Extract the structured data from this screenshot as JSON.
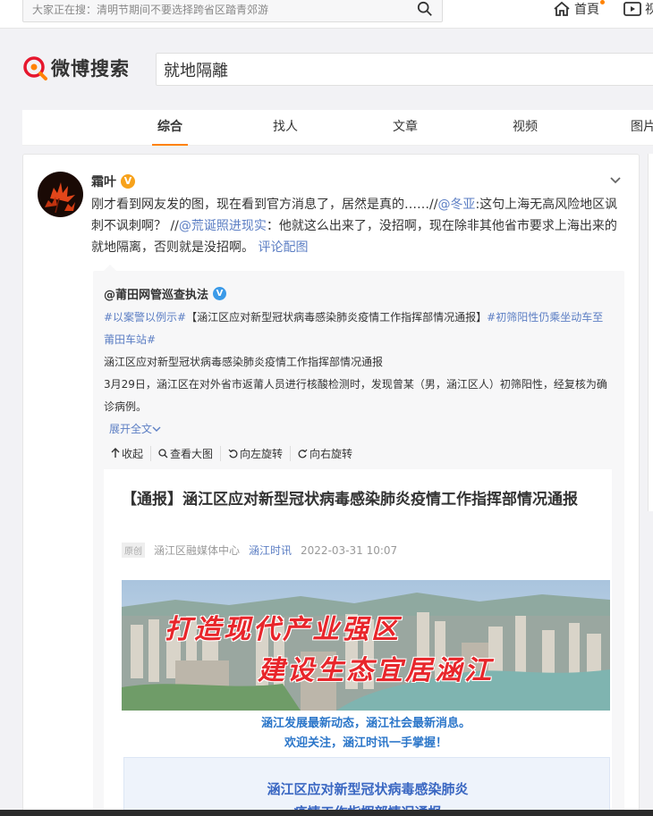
{
  "topbar": {
    "search_placeholder": "大家正在搜：清明节期间不要选择跨省区踏青郊游",
    "home_label": "首頁",
    "video_label": "视"
  },
  "header": {
    "logo_text": "微博搜索",
    "search_value": "就地隔離"
  },
  "tabs": [
    {
      "label": "综合",
      "active": true
    },
    {
      "label": "找人",
      "active": false
    },
    {
      "label": "文章",
      "active": false
    },
    {
      "label": "视频",
      "active": false
    },
    {
      "label": "图片",
      "active": false
    }
  ],
  "post": {
    "username": "霜叶",
    "verified_badge": "V",
    "text_part1": "刚才看到网友发的图，现在看到官方消息了，居然是真的……//",
    "mention1": "@冬亚",
    "text_part2": ":这句上海无高风险地区讽刺不讽刺啊？ //",
    "mention2": "@荒诞照进现实",
    "text_part3": "：他就这么出来了，没招啊，现在除非其他省市要求上海出来的就地隔离，否则就是没招啊。",
    "comment_link": "评论配图"
  },
  "repost": {
    "username": "@莆田网管巡查执法",
    "verified_badge": "V",
    "hashtag1": "#以案警以例示#",
    "headline": "【涵江区应对新型冠状病毒感染肺炎疫情工作指挥部情况通报】",
    "hashtag2": "#初筛阳性仍乘坐动车至莆田车站#",
    "line2": "涵江区应对新型冠状病毒感染肺炎疫情工作指挥部情况通报",
    "line3": "3月29日，涵江区在对外省市返莆人员进行核酸检测时，发现曾某（男，涵江区人）初筛阳性，经复核为确诊病例。",
    "expand": "展开全文",
    "toolbar": [
      "收起",
      "查看大图",
      "向左旋转",
      "向右旋转"
    ]
  },
  "article": {
    "title": "【通报】涵江区应对新型冠状病毒感染肺炎疫情工作指挥部情况通报",
    "meta_tag": "原创",
    "meta_source": "涵江区融媒体中心",
    "meta_account": "涵江时讯",
    "meta_time": "2022-03-31 10:07",
    "banner_line1": "打造现代产业强区",
    "banner_line2": "建设生态宜居涵江",
    "slogan_line1": "涵江发展最新动态，涵江社会最新消息。",
    "slogan_line2": "欢迎关注，涵江时讯一手掌握！",
    "notice_line1": "涵江区应对新型冠状病毒感染肺炎",
    "notice_line2": "疫情工作指挥部情况通报"
  },
  "colors": {
    "accent": "#ff8200",
    "link": "#5d7fc4",
    "banner_red": "#e8262b"
  }
}
